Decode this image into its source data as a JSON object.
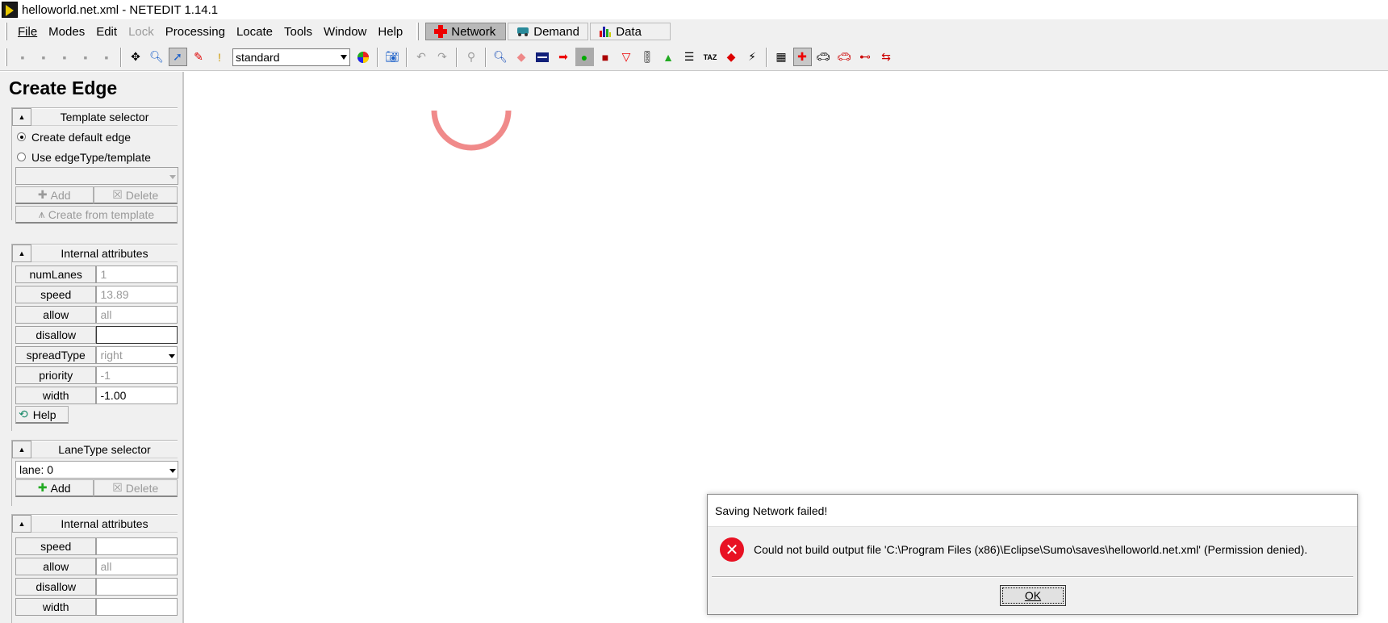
{
  "window": {
    "title": "helloworld.net.xml - NETEDIT 1.14.1"
  },
  "menubar": {
    "items": [
      "File",
      "Modes",
      "Edit",
      "Lock",
      "Processing",
      "Locate",
      "Tools",
      "Window",
      "Help"
    ],
    "supermodes": [
      "Network",
      "Demand",
      "Data"
    ]
  },
  "toolbar": {
    "scheme_value": "standard"
  },
  "sidebar": {
    "title": "Create Edge",
    "template_selector": {
      "title": "Template selector",
      "option_default": "Create default edge",
      "option_template": "Use edgeType/template",
      "add": "Add",
      "delete": "Delete",
      "create_from_template": "Create from template"
    },
    "internal_attributes": {
      "title": "Internal attributes",
      "rows": [
        {
          "label": "numLanes",
          "value": "1"
        },
        {
          "label": "speed",
          "value": "13.89"
        },
        {
          "label": "allow",
          "value": "all"
        },
        {
          "label": "disallow",
          "value": ""
        },
        {
          "label": "spreadType",
          "value": "right"
        },
        {
          "label": "priority",
          "value": "-1"
        },
        {
          "label": "width",
          "value": "-1.00"
        }
      ],
      "help": "Help"
    },
    "lanetype_selector": {
      "title": "LaneType selector",
      "value": "lane: 0",
      "add": "Add",
      "delete": "Delete"
    },
    "lane_internal_attributes": {
      "title": "Internal attributes",
      "rows": [
        {
          "label": "speed",
          "value": ""
        },
        {
          "label": "allow",
          "value": "all"
        },
        {
          "label": "disallow",
          "value": ""
        },
        {
          "label": "width",
          "value": ""
        }
      ]
    }
  },
  "dialog": {
    "title": "Saving Network failed!",
    "message": "Could not build output file 'C:\\Program Files (x86)\\Eclipse\\Sumo\\saves\\helloworld.net.xml' (Permission denied).",
    "ok": "OK"
  }
}
